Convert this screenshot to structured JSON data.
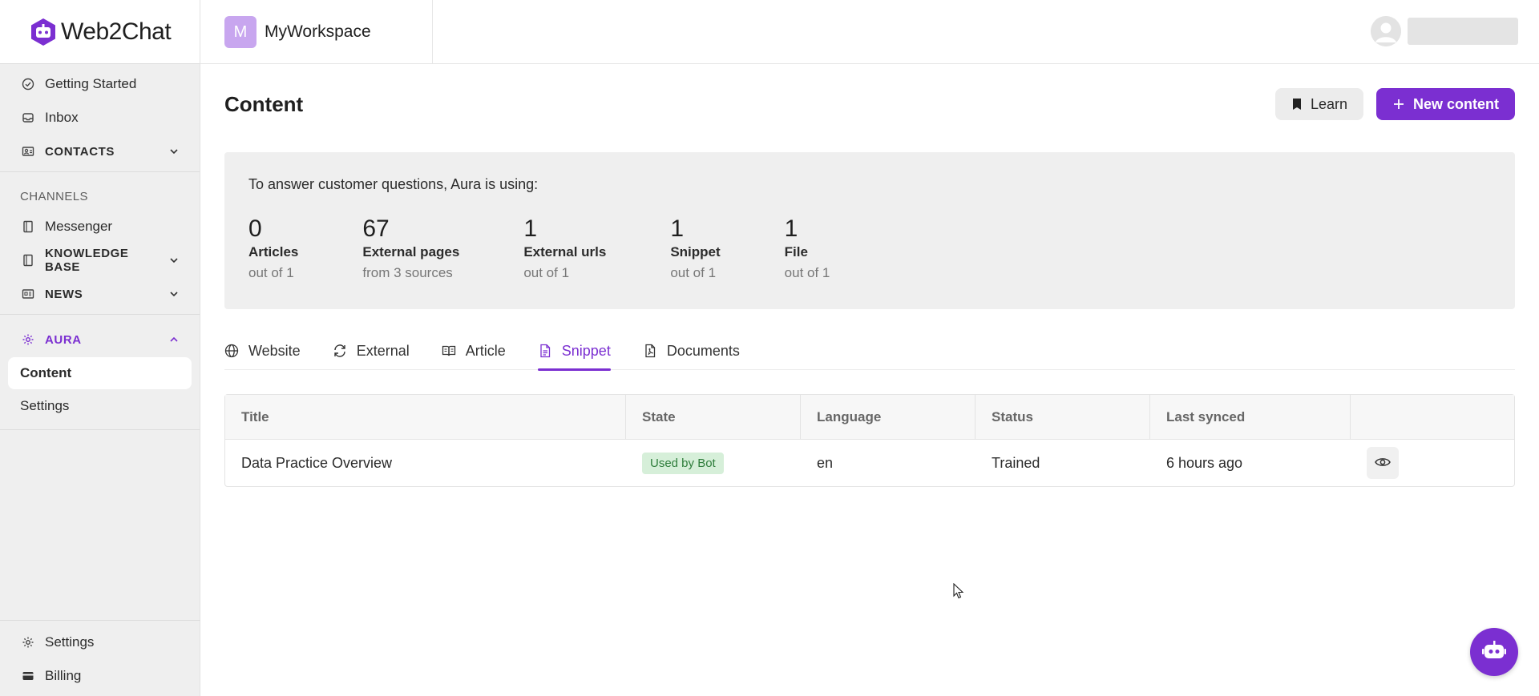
{
  "app": {
    "name": "Web2Chat",
    "brand_color": "#7b2fd1"
  },
  "sidebar": {
    "top_items": [
      {
        "label": "Getting Started",
        "icon": "check-circle-icon"
      },
      {
        "label": "Inbox",
        "icon": "inbox-icon"
      },
      {
        "label": "CONTACTS",
        "icon": "contacts-icon",
        "expandable": true,
        "expanded": false
      }
    ],
    "channels_label": "CHANNELS",
    "channel_items": [
      {
        "label": "Messenger",
        "icon": "book-icon"
      },
      {
        "label": "KNOWLEDGE BASE",
        "icon": "book-icon",
        "expandable": true,
        "expanded": false
      },
      {
        "label": "NEWS",
        "icon": "newspaper-icon",
        "expandable": true,
        "expanded": false
      }
    ],
    "aura": {
      "label": "AURA",
      "icon": "gear-icon",
      "expanded": true,
      "items": [
        {
          "label": "Content",
          "active": true
        },
        {
          "label": "Settings",
          "active": false
        }
      ]
    },
    "bottom_items": [
      {
        "label": "Settings",
        "icon": "gear-icon"
      },
      {
        "label": "Billing",
        "icon": "credit-card-icon"
      }
    ]
  },
  "topbar": {
    "workspace_initial": "M",
    "workspace_name": "MyWorkspace"
  },
  "page": {
    "title": "Content",
    "learn_label": "Learn",
    "new_content_label": "New content"
  },
  "summary": {
    "lead": "To answer customer questions, Aura is using:",
    "stats": [
      {
        "value": "0",
        "label": "Articles",
        "sub": "out of 1"
      },
      {
        "value": "67",
        "label": "External pages",
        "sub": "from 3 sources"
      },
      {
        "value": "1",
        "label": "External urls",
        "sub": "out of 1"
      },
      {
        "value": "1",
        "label": "Snippet",
        "sub": "out of 1"
      },
      {
        "value": "1",
        "label": "File",
        "sub": "out of 1"
      }
    ]
  },
  "tabs": [
    {
      "label": "Website",
      "icon": "globe-icon",
      "active": false
    },
    {
      "label": "External",
      "icon": "refresh-icon",
      "active": false
    },
    {
      "label": "Article",
      "icon": "open-book-icon",
      "active": false
    },
    {
      "label": "Snippet",
      "icon": "document-icon",
      "active": true
    },
    {
      "label": "Documents",
      "icon": "pdf-document-icon",
      "active": false
    }
  ],
  "table": {
    "columns": [
      "Title",
      "State",
      "Language",
      "Status",
      "Last synced",
      ""
    ],
    "rows": [
      {
        "title": "Data Practice Overview",
        "state": "Used by Bot",
        "language": "en",
        "status": "Trained",
        "last_synced": "6 hours ago"
      }
    ]
  }
}
